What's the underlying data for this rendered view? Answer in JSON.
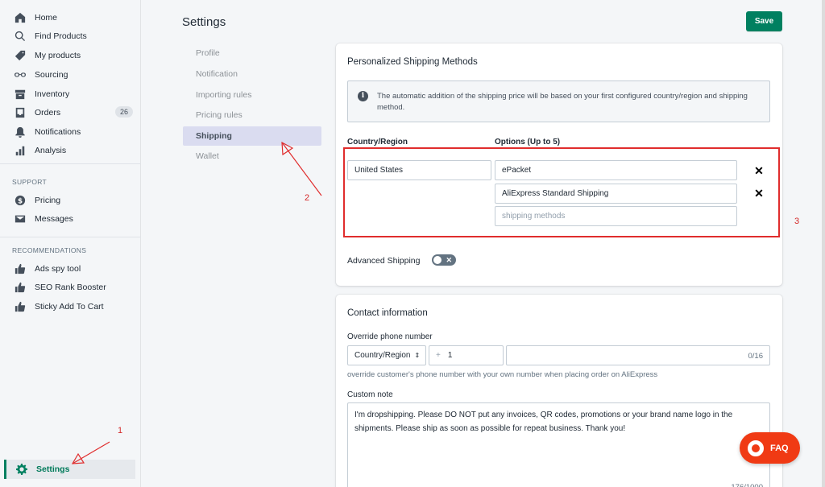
{
  "sidebar": {
    "items": [
      {
        "label": "Home",
        "icon": "home-icon"
      },
      {
        "label": "Find Products",
        "icon": "search-icon"
      },
      {
        "label": "My products",
        "icon": "tag-icon"
      },
      {
        "label": "Sourcing",
        "icon": "glasses-icon"
      },
      {
        "label": "Inventory",
        "icon": "box-icon"
      },
      {
        "label": "Orders",
        "icon": "inbox-icon",
        "badge": "26"
      },
      {
        "label": "Notifications",
        "icon": "bell-icon"
      },
      {
        "label": "Analysis",
        "icon": "bar-chart-icon"
      }
    ],
    "support_label": "SUPPORT",
    "support_items": [
      {
        "label": "Pricing",
        "icon": "dollar-icon"
      },
      {
        "label": "Messages",
        "icon": "envelope-icon"
      }
    ],
    "recommendations_label": "RECOMMENDATIONS",
    "recommendation_items": [
      {
        "label": "Ads spy tool",
        "icon": "thumbs-up-icon"
      },
      {
        "label": "SEO Rank Booster",
        "icon": "thumbs-up-icon"
      },
      {
        "label": "Sticky Add To Cart",
        "icon": "thumbs-up-icon"
      }
    ],
    "settings_label": "Settings"
  },
  "page": {
    "title": "Settings",
    "save_label": "Save"
  },
  "settings_nav": [
    "Profile",
    "Notification",
    "Importing rules",
    "Pricing rules",
    "Shipping",
    "Wallet"
  ],
  "shipping_card": {
    "title": "Personalized Shipping Methods",
    "info": "The automatic addition of the shipping price will be based on your first configured country/region and shipping method.",
    "country_header": "Country/Region",
    "options_header": "Options (Up to 5)",
    "country_value": "United States",
    "options": [
      "ePacket",
      "AliExpress Standard Shipping"
    ],
    "options_placeholder": "shipping methods",
    "advanced_label": "Advanced Shipping",
    "remove_symbol": "✕"
  },
  "contact_card": {
    "title": "Contact information",
    "phone_label": "Override phone number",
    "country_select": "Country/Region",
    "plus": "+",
    "dial_code": "1",
    "phone_counter": "0/16",
    "phone_help": "override customer's phone number with your own number when placing order on AliExpress",
    "note_label": "Custom note",
    "note_text": "I'm dropshipping. Please DO NOT put any invoices, QR codes, promotions or your brand name logo in the shipments. Please ship as soon as possible for repeat business. Thank you!",
    "note_counter": "176/1000"
  },
  "annotations": [
    "1",
    "2",
    "3"
  ],
  "faq_label": "FAQ",
  "colors": {
    "accent": "#008060",
    "annotation": "#e02d2d",
    "faq": "#f03a14"
  }
}
